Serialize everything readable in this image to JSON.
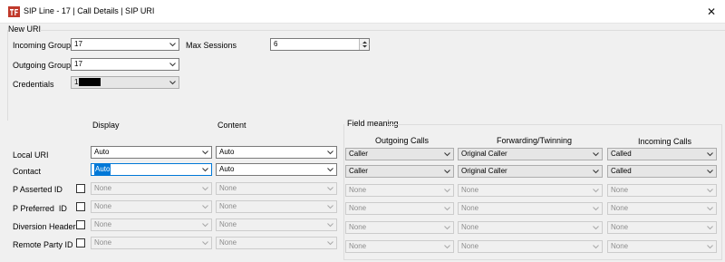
{
  "window": {
    "title": "SIP Line - 17 | Call Details | SIP URI",
    "close_glyph": "✕"
  },
  "new_uri": {
    "legend": "New URI",
    "incoming_group": {
      "label": "Incoming Group",
      "value": "17"
    },
    "outgoing_group": {
      "label": "Outgoing Group",
      "value": "17"
    },
    "credentials": {
      "label": "Credentials",
      "value": "1"
    },
    "max_sessions": {
      "label": "Max Sessions",
      "value": "6"
    }
  },
  "headers": {
    "display": "Display",
    "content": "Content",
    "field_meaning": "Field meaning",
    "outgoing_calls": "Outgoing Calls",
    "forwarding_twinning": "Forwarding/Twinning",
    "incoming_calls": "Incoming Calls"
  },
  "rows": [
    {
      "label": "Local URI",
      "display": "Auto",
      "content": "Auto",
      "outgoing": "Caller",
      "forwarding": "Original Caller",
      "incoming": "Called"
    },
    {
      "label": "Contact",
      "display": "Auto",
      "content": "Auto",
      "outgoing": "Caller",
      "forwarding": "Original Caller",
      "incoming": "Called"
    },
    {
      "label": "P Asserted ID",
      "display": "None",
      "content": "None",
      "outgoing": "None",
      "forwarding": "None",
      "incoming": "None"
    },
    {
      "label": "P Preferred  ID",
      "display": "None",
      "content": "None",
      "outgoing": "None",
      "forwarding": "None",
      "incoming": "None"
    },
    {
      "label": "Diversion Header",
      "display": "None",
      "content": "None",
      "outgoing": "None",
      "forwarding": "None",
      "incoming": "None"
    },
    {
      "label": "Remote Party ID",
      "display": "None",
      "content": "None",
      "outgoing": "None",
      "forwarding": "None",
      "incoming": "None"
    }
  ],
  "colors": {
    "focus_border": "#0078d7",
    "selection": "#0078d7",
    "window_bg": "#f0f0f0"
  },
  "icons": {
    "app": "sip-line-app-icon",
    "combo_arrow": "chevron-down-icon",
    "spin": "spin-updown-icon"
  }
}
